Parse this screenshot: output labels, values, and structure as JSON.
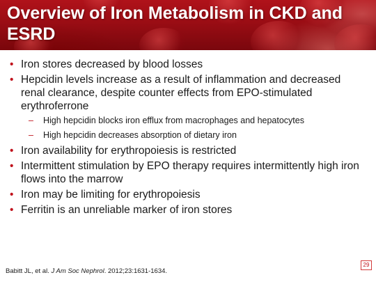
{
  "slide": {
    "title": "Overview of Iron Metabolism in CKD and ESRD",
    "bullets": [
      "Iron stores decreased by blood losses",
      "Hepcidin levels increase as a result of inflammation and decreased renal clearance, despite counter effects from EPO-stimulated erythroferrone",
      "Iron availability for erythropoiesis is restricted",
      "Intermittent stimulation by EPO therapy requires intermittently high iron flows into the marrow",
      "Iron may be limiting for erythropoiesis",
      "Ferritin is an unreliable marker of iron stores"
    ],
    "sub_bullets": [
      "High hepcidin blocks iron efflux from macrophages and hepatocytes",
      "High hepcidin decreases absorption of dietary iron"
    ],
    "citation": {
      "authors": "Babitt JL, et al.",
      "journal": "J Am Soc Nephrol",
      "details": ". 2012;23:1631-1634."
    },
    "page_number": "29"
  },
  "colors": {
    "header_red": "#9a0d14",
    "bullet_red": "#c0121c",
    "text": "#1a1a1a"
  }
}
